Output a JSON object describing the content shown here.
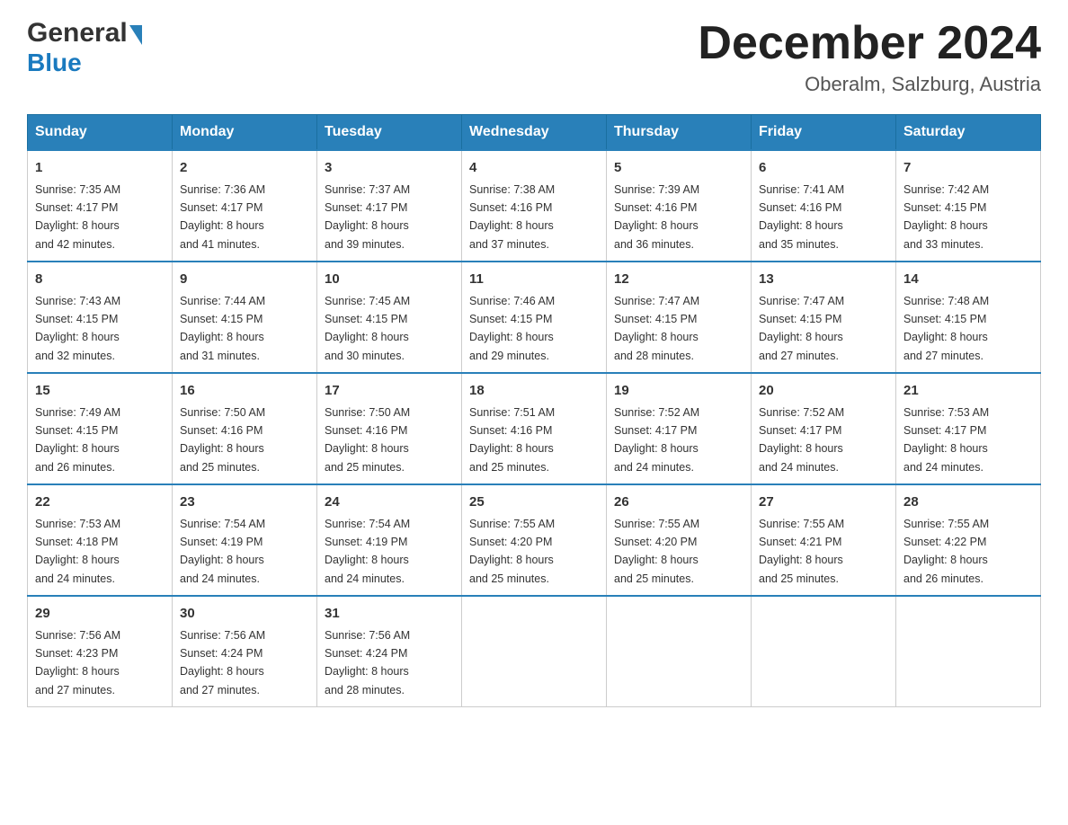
{
  "header": {
    "logo_general": "General",
    "logo_blue": "Blue",
    "month_title": "December 2024",
    "location": "Oberalm, Salzburg, Austria"
  },
  "days_of_week": [
    "Sunday",
    "Monday",
    "Tuesday",
    "Wednesday",
    "Thursday",
    "Friday",
    "Saturday"
  ],
  "weeks": [
    [
      {
        "day": "1",
        "sunrise": "7:35 AM",
        "sunset": "4:17 PM",
        "daylight": "8 hours and 42 minutes."
      },
      {
        "day": "2",
        "sunrise": "7:36 AM",
        "sunset": "4:17 PM",
        "daylight": "8 hours and 41 minutes."
      },
      {
        "day": "3",
        "sunrise": "7:37 AM",
        "sunset": "4:17 PM",
        "daylight": "8 hours and 39 minutes."
      },
      {
        "day": "4",
        "sunrise": "7:38 AM",
        "sunset": "4:16 PM",
        "daylight": "8 hours and 37 minutes."
      },
      {
        "day": "5",
        "sunrise": "7:39 AM",
        "sunset": "4:16 PM",
        "daylight": "8 hours and 36 minutes."
      },
      {
        "day": "6",
        "sunrise": "7:41 AM",
        "sunset": "4:16 PM",
        "daylight": "8 hours and 35 minutes."
      },
      {
        "day": "7",
        "sunrise": "7:42 AM",
        "sunset": "4:15 PM",
        "daylight": "8 hours and 33 minutes."
      }
    ],
    [
      {
        "day": "8",
        "sunrise": "7:43 AM",
        "sunset": "4:15 PM",
        "daylight": "8 hours and 32 minutes."
      },
      {
        "day": "9",
        "sunrise": "7:44 AM",
        "sunset": "4:15 PM",
        "daylight": "8 hours and 31 minutes."
      },
      {
        "day": "10",
        "sunrise": "7:45 AM",
        "sunset": "4:15 PM",
        "daylight": "8 hours and 30 minutes."
      },
      {
        "day": "11",
        "sunrise": "7:46 AM",
        "sunset": "4:15 PM",
        "daylight": "8 hours and 29 minutes."
      },
      {
        "day": "12",
        "sunrise": "7:47 AM",
        "sunset": "4:15 PM",
        "daylight": "8 hours and 28 minutes."
      },
      {
        "day": "13",
        "sunrise": "7:47 AM",
        "sunset": "4:15 PM",
        "daylight": "8 hours and 27 minutes."
      },
      {
        "day": "14",
        "sunrise": "7:48 AM",
        "sunset": "4:15 PM",
        "daylight": "8 hours and 27 minutes."
      }
    ],
    [
      {
        "day": "15",
        "sunrise": "7:49 AM",
        "sunset": "4:15 PM",
        "daylight": "8 hours and 26 minutes."
      },
      {
        "day": "16",
        "sunrise": "7:50 AM",
        "sunset": "4:16 PM",
        "daylight": "8 hours and 25 minutes."
      },
      {
        "day": "17",
        "sunrise": "7:50 AM",
        "sunset": "4:16 PM",
        "daylight": "8 hours and 25 minutes."
      },
      {
        "day": "18",
        "sunrise": "7:51 AM",
        "sunset": "4:16 PM",
        "daylight": "8 hours and 25 minutes."
      },
      {
        "day": "19",
        "sunrise": "7:52 AM",
        "sunset": "4:17 PM",
        "daylight": "8 hours and 24 minutes."
      },
      {
        "day": "20",
        "sunrise": "7:52 AM",
        "sunset": "4:17 PM",
        "daylight": "8 hours and 24 minutes."
      },
      {
        "day": "21",
        "sunrise": "7:53 AM",
        "sunset": "4:17 PM",
        "daylight": "8 hours and 24 minutes."
      }
    ],
    [
      {
        "day": "22",
        "sunrise": "7:53 AM",
        "sunset": "4:18 PM",
        "daylight": "8 hours and 24 minutes."
      },
      {
        "day": "23",
        "sunrise": "7:54 AM",
        "sunset": "4:19 PM",
        "daylight": "8 hours and 24 minutes."
      },
      {
        "day": "24",
        "sunrise": "7:54 AM",
        "sunset": "4:19 PM",
        "daylight": "8 hours and 24 minutes."
      },
      {
        "day": "25",
        "sunrise": "7:55 AM",
        "sunset": "4:20 PM",
        "daylight": "8 hours and 25 minutes."
      },
      {
        "day": "26",
        "sunrise": "7:55 AM",
        "sunset": "4:20 PM",
        "daylight": "8 hours and 25 minutes."
      },
      {
        "day": "27",
        "sunrise": "7:55 AM",
        "sunset": "4:21 PM",
        "daylight": "8 hours and 25 minutes."
      },
      {
        "day": "28",
        "sunrise": "7:55 AM",
        "sunset": "4:22 PM",
        "daylight": "8 hours and 26 minutes."
      }
    ],
    [
      {
        "day": "29",
        "sunrise": "7:56 AM",
        "sunset": "4:23 PM",
        "daylight": "8 hours and 27 minutes."
      },
      {
        "day": "30",
        "sunrise": "7:56 AM",
        "sunset": "4:24 PM",
        "daylight": "8 hours and 27 minutes."
      },
      {
        "day": "31",
        "sunrise": "7:56 AM",
        "sunset": "4:24 PM",
        "daylight": "8 hours and 28 minutes."
      },
      null,
      null,
      null,
      null
    ]
  ],
  "labels": {
    "sunrise": "Sunrise:",
    "sunset": "Sunset:",
    "daylight": "Daylight:"
  }
}
